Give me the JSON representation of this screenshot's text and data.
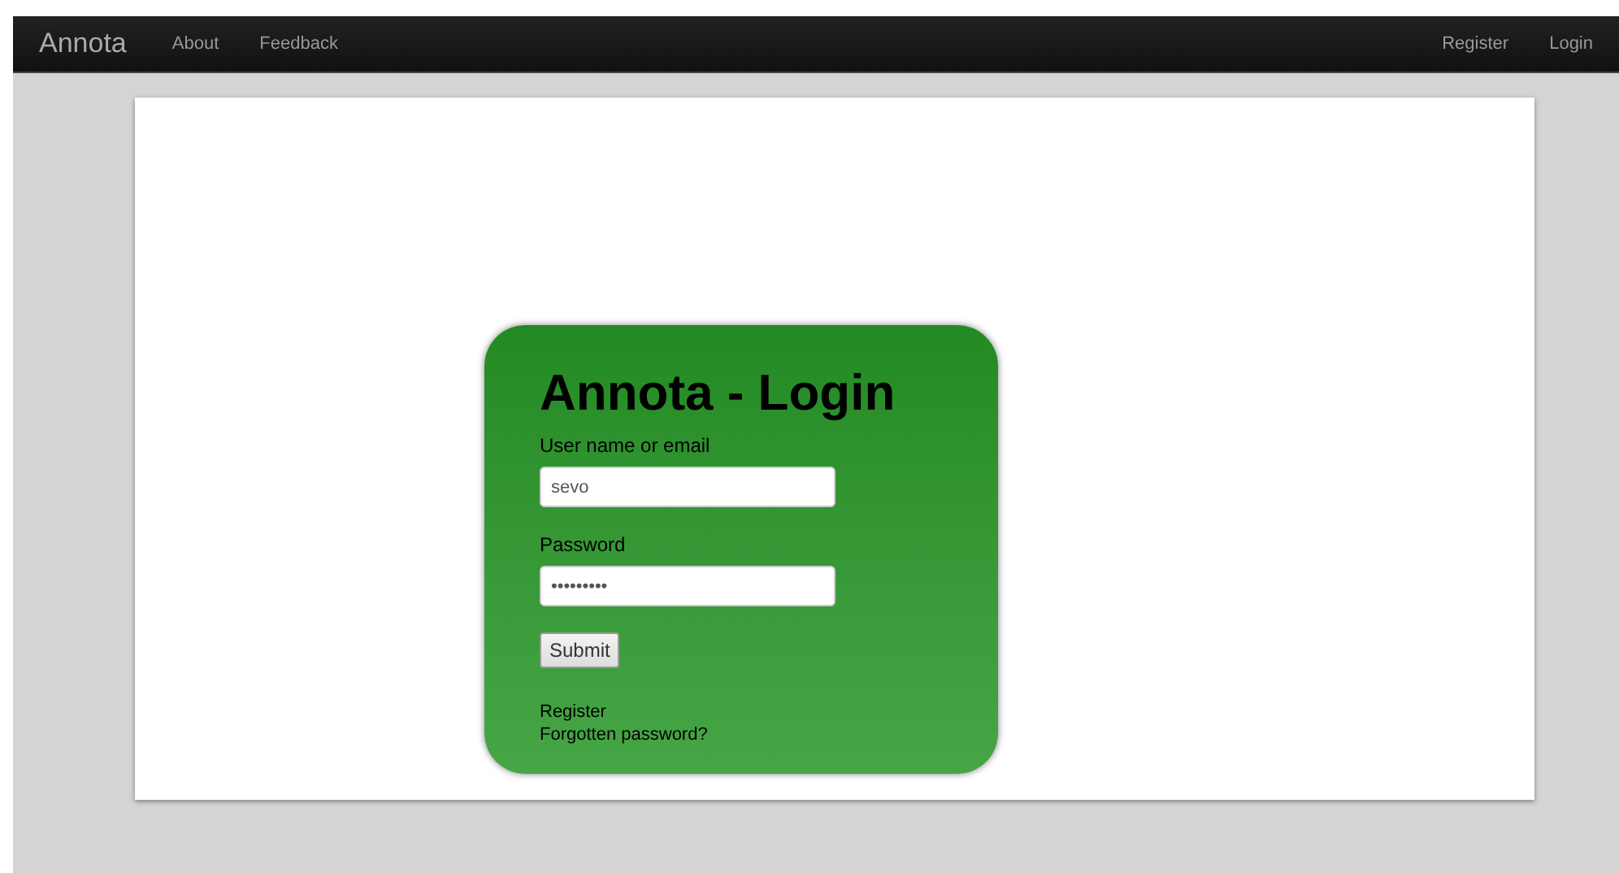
{
  "navbar": {
    "brand": "Annota",
    "left_links": [
      "About",
      "Feedback"
    ],
    "right_links": [
      "Register",
      "Login"
    ]
  },
  "login": {
    "title": "Annota - Login",
    "fields": [
      {
        "label": "User name or email",
        "value": "sevo"
      },
      {
        "label": "Password",
        "value": "•••••••••"
      }
    ],
    "submit": "Submit",
    "links": [
      "Register",
      "Forgotten password?"
    ]
  }
}
